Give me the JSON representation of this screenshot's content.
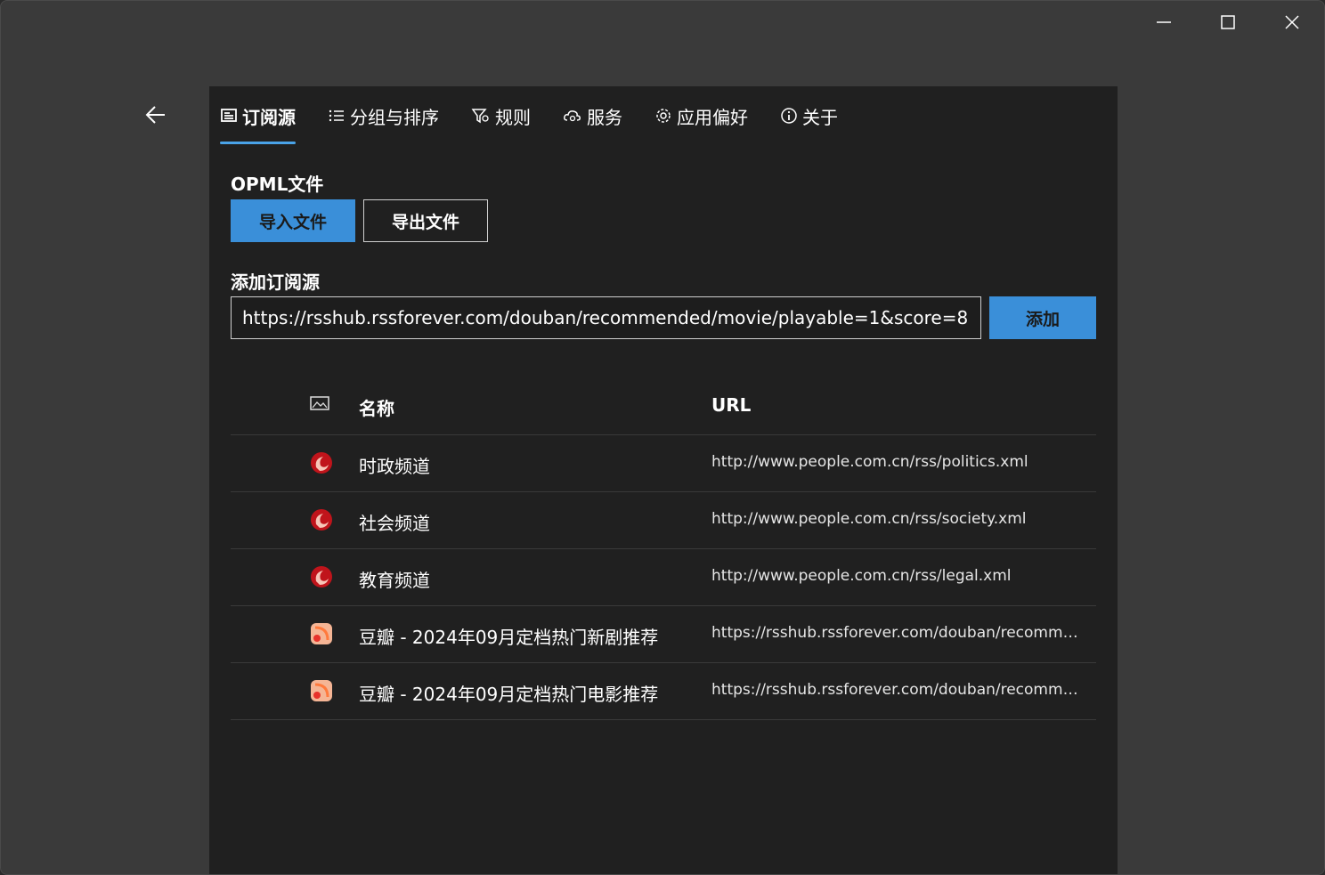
{
  "window": {
    "minimize_icon": "minimize-icon",
    "maximize_icon": "maximize-icon",
    "close_icon": "close-icon"
  },
  "tabs": [
    {
      "label": "订阅源",
      "icon": "feed-icon",
      "active": true
    },
    {
      "label": "分组与排序",
      "icon": "list-icon",
      "active": false
    },
    {
      "label": "规则",
      "icon": "filter-icon",
      "active": false
    },
    {
      "label": "服务",
      "icon": "cloud-sync-icon",
      "active": false
    },
    {
      "label": "应用偏好",
      "icon": "gear-icon",
      "active": false
    },
    {
      "label": "关于",
      "icon": "info-icon",
      "active": false
    }
  ],
  "opml": {
    "label": "OPML文件",
    "import_label": "导入文件",
    "export_label": "导出文件"
  },
  "add_source": {
    "label": "添加订阅源",
    "url_value": "https://rsshub.rssforever.com/douban/recommended/movie/playable=1&score=8",
    "add_label": "添加"
  },
  "table": {
    "columns": {
      "icon": "image-icon",
      "name": "名称",
      "url": "URL"
    },
    "rows": [
      {
        "name": "时政频道",
        "url": "http://www.people.com.cn/rss/politics.xml",
        "icon": "people-daily-icon"
      },
      {
        "name": "社会频道",
        "url": "http://www.people.com.cn/rss/society.xml",
        "icon": "people-daily-icon"
      },
      {
        "name": "教育频道",
        "url": "http://www.people.com.cn/rss/legal.xml",
        "icon": "people-daily-icon"
      },
      {
        "name": "豆瓣 - 2024年09月定档热门新剧推荐",
        "url": "https://rsshub.rssforever.com/douban/recommend...",
        "icon": "rss-icon"
      },
      {
        "name": "豆瓣 - 2024年09月定档热门电影推荐",
        "url": "https://rsshub.rssforever.com/douban/recommend...",
        "icon": "rss-icon"
      }
    ]
  },
  "colors": {
    "accent": "#3a8fd9",
    "panel_bg": "#202020",
    "window_bg": "#3a3a3a"
  }
}
